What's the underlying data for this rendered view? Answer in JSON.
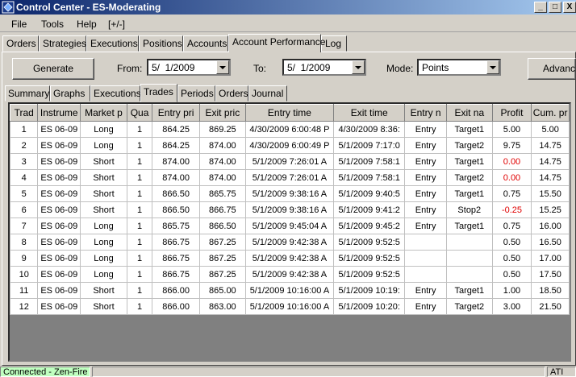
{
  "window": {
    "title": "Control Center - ES-Moderating",
    "min": "_",
    "max": "□",
    "close": "X"
  },
  "menu": [
    "File",
    "Tools",
    "Help",
    "[+/-]"
  ],
  "tabs": [
    "Orders",
    "Strategies",
    "Executions",
    "Positions",
    "Accounts",
    "Account Performance",
    "Log"
  ],
  "toolbar": {
    "generate": "Generate",
    "from_label": "From:",
    "from_value": "5/  1/2009",
    "to_label": "To:",
    "to_value": "5/  1/2009",
    "mode_label": "Mode:",
    "mode_value": "Points",
    "advanced": "Advanc"
  },
  "subtabs": [
    "Summary",
    "Graphs",
    "Executions",
    "Trades",
    "Periods",
    "Orders",
    "Journal"
  ],
  "columns": [
    "Trad",
    "Instrume",
    "Market p",
    "Qua",
    "Entry pri",
    "Exit pric",
    "Entry time",
    "Exit time",
    "Entry n",
    "Exit na",
    "Profit",
    "Cum. pr"
  ],
  "rows": [
    [
      "1",
      "ES 06-09",
      "Long",
      "1",
      "864.25",
      "869.25",
      "4/30/2009 6:00:48 P",
      "4/30/2009 8:36:",
      "Entry",
      "Target1",
      "5.00",
      "5.00"
    ],
    [
      "2",
      "ES 06-09",
      "Long",
      "1",
      "864.25",
      "874.00",
      "4/30/2009 6:00:49 P",
      "5/1/2009 7:17:0",
      "Entry",
      "Target2",
      "9.75",
      "14.75"
    ],
    [
      "3",
      "ES 06-09",
      "Short",
      "1",
      "874.00",
      "874.00",
      "5/1/2009 7:26:01 A",
      "5/1/2009 7:58:1",
      "Entry",
      "Target1",
      "0.00",
      "14.75"
    ],
    [
      "4",
      "ES 06-09",
      "Short",
      "1",
      "874.00",
      "874.00",
      "5/1/2009 7:26:01 A",
      "5/1/2009 7:58:1",
      "Entry",
      "Target2",
      "0.00",
      "14.75"
    ],
    [
      "5",
      "ES 06-09",
      "Short",
      "1",
      "866.50",
      "865.75",
      "5/1/2009 9:38:16 A",
      "5/1/2009 9:40:5",
      "Entry",
      "Target1",
      "0.75",
      "15.50"
    ],
    [
      "6",
      "ES 06-09",
      "Short",
      "1",
      "866.50",
      "866.75",
      "5/1/2009 9:38:16 A",
      "5/1/2009 9:41:2",
      "Entry",
      "Stop2",
      "-0.25",
      "15.25"
    ],
    [
      "7",
      "ES 06-09",
      "Long",
      "1",
      "865.75",
      "866.50",
      "5/1/2009 9:45:04 A",
      "5/1/2009 9:45:2",
      "Entry",
      "Target1",
      "0.75",
      "16.00"
    ],
    [
      "8",
      "ES 06-09",
      "Long",
      "1",
      "866.75",
      "867.25",
      "5/1/2009 9:42:38 A",
      "5/1/2009 9:52:5",
      "",
      "",
      "0.50",
      "16.50"
    ],
    [
      "9",
      "ES 06-09",
      "Long",
      "1",
      "866.75",
      "867.25",
      "5/1/2009 9:42:38 A",
      "5/1/2009 9:52:5",
      "",
      "",
      "0.50",
      "17.00"
    ],
    [
      "10",
      "ES 06-09",
      "Long",
      "1",
      "866.75",
      "867.25",
      "5/1/2009 9:42:38 A",
      "5/1/2009 9:52:5",
      "",
      "",
      "0.50",
      "17.50"
    ],
    [
      "11",
      "ES 06-09",
      "Short",
      "1",
      "866.00",
      "865.00",
      "5/1/2009 10:16:00 A",
      "5/1/2009 10:19:",
      "Entry",
      "Target1",
      "1.00",
      "18.50"
    ],
    [
      "12",
      "ES 06-09",
      "Short",
      "1",
      "866.00",
      "863.00",
      "5/1/2009 10:16:00 A",
      "5/1/2009 10:20:",
      "Entry",
      "Target2",
      "3.00",
      "21.50"
    ]
  ],
  "neg_profit_color": "#e00000",
  "status": {
    "connection": "Connected - Zen-Fire",
    "connection_color": "#c0ffc0",
    "right": "ATI"
  }
}
